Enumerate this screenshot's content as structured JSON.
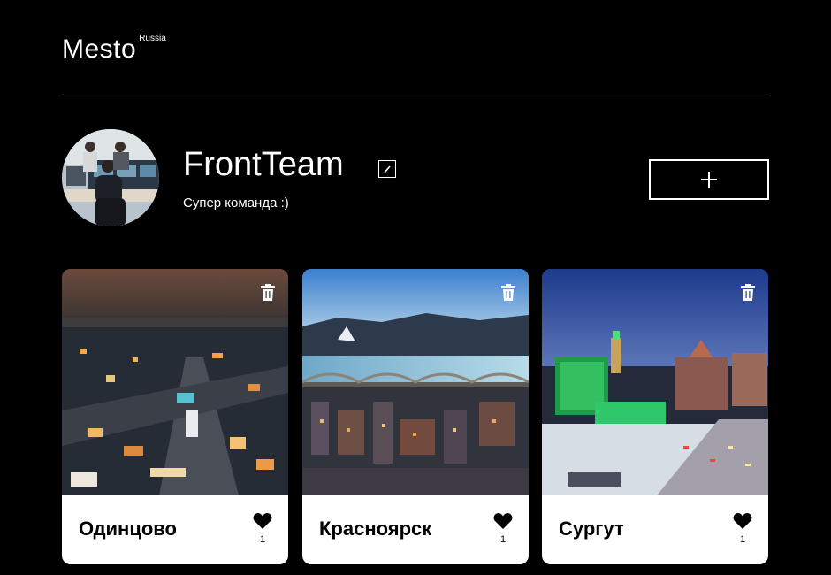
{
  "header": {
    "logo_main": "Mesto",
    "logo_sub": "Russia"
  },
  "profile": {
    "name": "FrontTeam",
    "about": "Супер команда :)"
  },
  "icons": {
    "edit": "pencil-icon",
    "add": "plus-icon",
    "delete": "trash-icon",
    "like": "heart-icon"
  },
  "cards": [
    {
      "title": "Одинцово",
      "likes": "1"
    },
    {
      "title": "Красноярск",
      "likes": "1"
    },
    {
      "title": "Сургут",
      "likes": "1"
    }
  ]
}
